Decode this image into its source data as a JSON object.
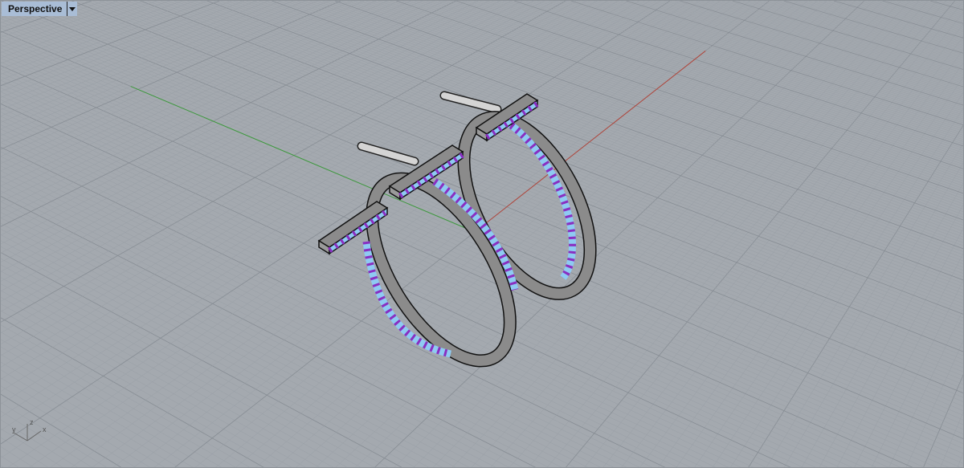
{
  "viewport": {
    "title": "Perspective",
    "dropdown_icon": "triangle-down",
    "axis_labels": {
      "x": "x",
      "y": "y",
      "z": "z"
    }
  },
  "colors": {
    "background": "#a4a9af",
    "grid_minor": "#999fa6",
    "grid_major": "#878d94",
    "x_axis": "#b0463c",
    "y_axis": "#3e9a3e",
    "metal": "#8b8b8b",
    "stone": "#8fcaf2",
    "prong": "#8a2fc0"
  }
}
